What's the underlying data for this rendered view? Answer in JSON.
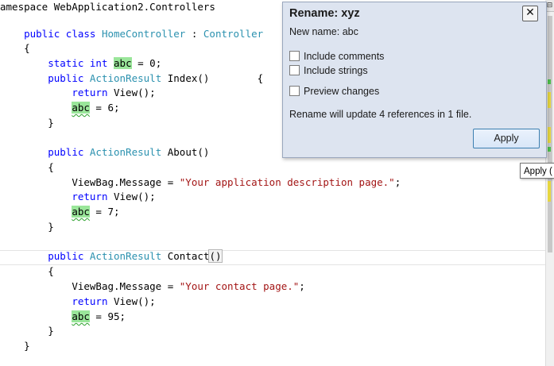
{
  "code": {
    "l1_prefix": "amespace WebApplication2.Controllers",
    "l2_kw": "public class",
    "l2_type": "HomeController",
    "l2_sep": ":",
    "l2_base": "Controller",
    "open_brace": "{",
    "close_brace": "}",
    "l4_kw": "static int",
    "rename_symbol": "abc",
    "l4_rest": "= 0;",
    "public_kw": "public",
    "action_result": "ActionResult",
    "index_sig": "Index()",
    "return_kw": "return",
    "view_call": "View();",
    "assign_6": "= 6;",
    "about_sig": "About()",
    "viewbag": "ViewBag.Message =",
    "about_str": "\"Your application description page.\"",
    "semicolon": ";",
    "assign_7": "= 7;",
    "contact_name": "Contact",
    "contact_parens": "()",
    "contact_str": "\"Your contact page.\"",
    "assign_95": "= 95;"
  },
  "rename_dialog": {
    "title": "Rename: xyz",
    "new_name_label": "New name: abc",
    "option_comments": "Include comments",
    "option_strings": "Include strings",
    "option_preview": "Preview changes",
    "summary": "Rename will update 4 references in 1 file.",
    "apply_label": "Apply",
    "close_glyph": "✕",
    "close_icon": "close-icon"
  },
  "tooltip": {
    "text": "Apply ("
  },
  "scrollbar": {
    "split_glyph": "⊟",
    "marker_colors": [
      "#e6d640",
      "#4cbf4c"
    ]
  }
}
